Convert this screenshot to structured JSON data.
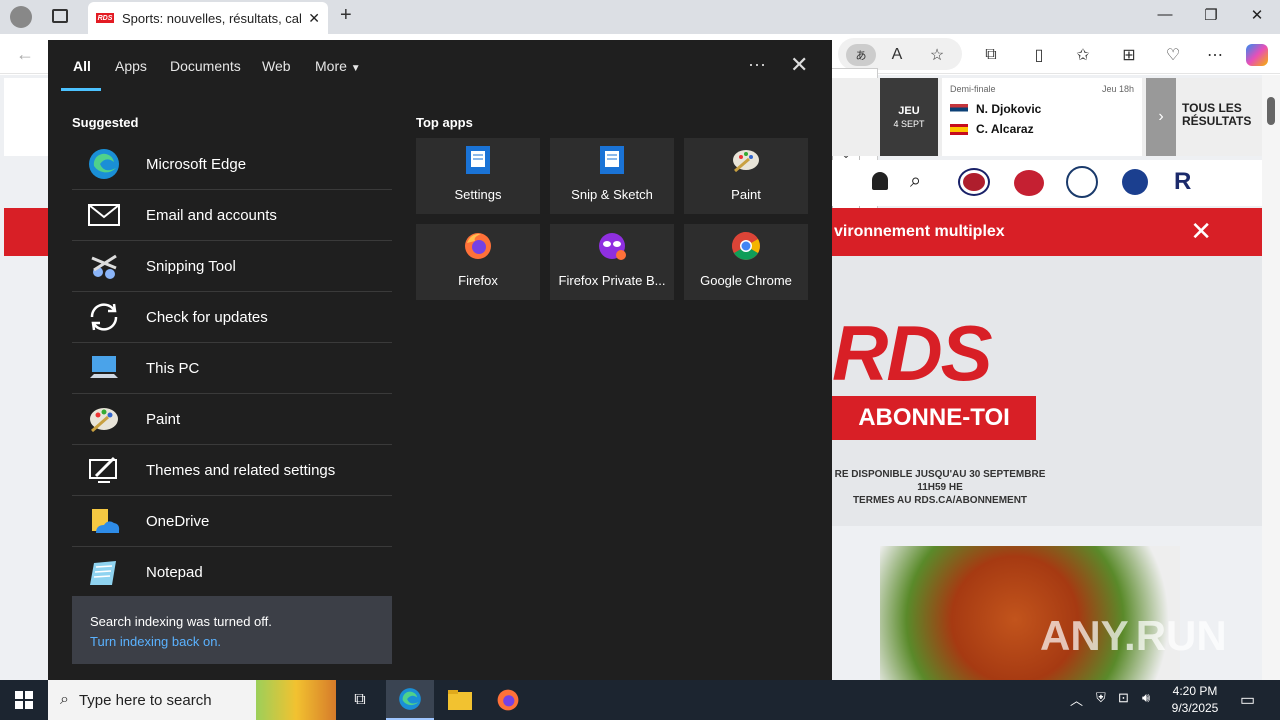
{
  "browser": {
    "tab_title": "Sports: nouvelles, résultats, calenc",
    "tab_favicon": "RDS"
  },
  "page": {
    "scoreboard": {
      "day": "JEU",
      "date": "4 SEPT",
      "round": "Demi-finale",
      "time": "Jeu 18h",
      "player1": "N. Djokovic",
      "player2": "C. Alcaraz",
      "all_results": "TOUS LES\nRÉSULTATS"
    },
    "banner_text": "vironnement multiplex",
    "ad": {
      "logo": "RDS",
      "button": "ABONNE-TOI",
      "fine_print_1": "RE DISPONIBLE JUSQU'AU 30 SEPTEMBRE 11H59 HE",
      "fine_print_2": "TERMES AU RDS.CA/ABONNEMENT"
    },
    "watermark": "ANY.RUN"
  },
  "search_panel": {
    "tabs": [
      "All",
      "Apps",
      "Documents",
      "Web",
      "More"
    ],
    "suggested_heading": "Suggested",
    "top_apps_heading": "Top apps",
    "suggested": [
      {
        "label": "Microsoft Edge",
        "icon": "edge-icon"
      },
      {
        "label": "Email and accounts",
        "icon": "mail-icon"
      },
      {
        "label": "Snipping Tool",
        "icon": "snipping-tool-icon"
      },
      {
        "label": "Check for updates",
        "icon": "refresh-icon"
      },
      {
        "label": "This PC",
        "icon": "computer-icon"
      },
      {
        "label": "Paint",
        "icon": "paint-icon"
      },
      {
        "label": "Themes and related settings",
        "icon": "themes-icon"
      },
      {
        "label": "OneDrive",
        "icon": "onedrive-icon"
      },
      {
        "label": "Notepad",
        "icon": "notepad-icon"
      }
    ],
    "top_apps": [
      {
        "label": "Settings",
        "icon": "settings-icon"
      },
      {
        "label": "Snip & Sketch",
        "icon": "snip-sketch-icon"
      },
      {
        "label": "Paint",
        "icon": "paint-icon"
      },
      {
        "label": "Firefox",
        "icon": "firefox-icon"
      },
      {
        "label": "Firefox Private B...",
        "icon": "firefox-private-icon"
      },
      {
        "label": "Google Chrome",
        "icon": "chrome-icon"
      }
    ],
    "notice_text": "Search indexing was turned off.",
    "notice_link": "Turn indexing back on."
  },
  "taskbar": {
    "search_placeholder": "Type here to search",
    "time": "4:20 PM",
    "date": "9/3/2025"
  }
}
